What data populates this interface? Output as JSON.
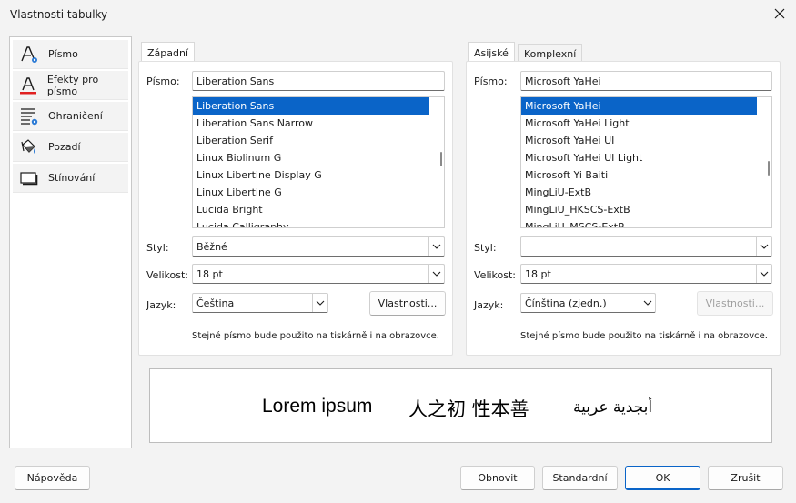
{
  "window": {
    "title": "Vlastnosti tabulky"
  },
  "sidebar": {
    "items": [
      {
        "label": "Písmo",
        "icon": "font-icon"
      },
      {
        "label": "Efekty pro písmo",
        "icon": "font-effects-icon"
      },
      {
        "label": "Ohraničení",
        "icon": "borders-icon"
      },
      {
        "label": "Pozadí",
        "icon": "background-icon"
      },
      {
        "label": "Stínování",
        "icon": "shadow-icon"
      }
    ]
  },
  "west": {
    "tab": "Západní",
    "font_label": "Písmo:",
    "font_value": "Liberation Sans",
    "font_list": [
      "Liberation Sans",
      "Liberation Sans Narrow",
      "Liberation Serif",
      "Linux Biolinum G",
      "Linux Libertine Display G",
      "Linux Libertine G",
      "Lucida Bright",
      "Lucida Calligraphy"
    ],
    "style_label": "Styl:",
    "style_value": "Běžné",
    "size_label": "Velikost:",
    "size_value": "18 pt",
    "lang_label": "Jazyk:",
    "lang_value": "Čeština",
    "features_button": "Vlastnosti...",
    "note": "Stejné písmo bude použito na tiskárně i na obrazovce."
  },
  "asian": {
    "tabs": [
      "Asijské",
      "Komplexní"
    ],
    "font_label": "Písmo:",
    "font_value": "Microsoft YaHei",
    "font_list": [
      "Microsoft YaHei",
      "Microsoft YaHei Light",
      "Microsoft YaHei UI",
      "Microsoft YaHei UI Light",
      "Microsoft Yi Baiti",
      "MingLiU-ExtB",
      "MingLiU_HKSCS-ExtB",
      "MingLiU_MSCS-ExtB"
    ],
    "style_label": "Styl:",
    "style_value": "",
    "size_label": "Velikost:",
    "size_value": "18 pt",
    "lang_label": "Jazyk:",
    "lang_value": "Čínština (zjedn.)",
    "features_button": "Vlastnosti...",
    "note": "Stejné písmo bude použito na tiskárně i na obrazovce."
  },
  "preview": {
    "western": "Lorem ipsum",
    "asian": "人之初 性本善",
    "complex": "أبجدية عربية"
  },
  "buttons": {
    "help": "Nápověda",
    "reset": "Obnovit",
    "standard": "Standardní",
    "ok": "OK",
    "cancel": "Zrušit"
  },
  "colors": {
    "selection": "#0a64c8",
    "effects_accent": "#e02020",
    "icon_blue": "#2a7ad5"
  }
}
